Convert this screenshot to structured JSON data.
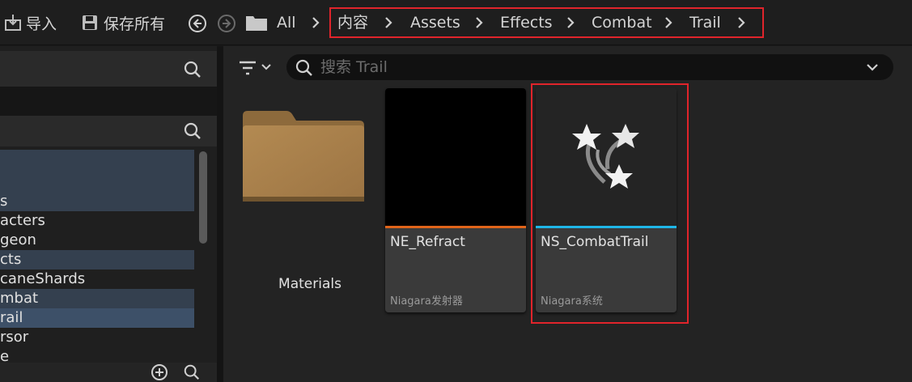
{
  "toolbar": {
    "import_label": "导入",
    "save_all_label": "保存所有"
  },
  "breadcrumb": {
    "root": "All",
    "items": [
      "内容",
      "Assets",
      "Effects",
      "Combat",
      "Trail"
    ]
  },
  "left_panel": {
    "tree_items": [
      "s",
      "acters",
      "geon",
      "cts",
      "caneShards",
      "mbat",
      "rail",
      "rsor",
      "e"
    ],
    "selected_item": "rail"
  },
  "content": {
    "search_placeholder": "搜索 Trail",
    "assets": [
      {
        "name": "Materials",
        "kind": "folder"
      },
      {
        "name": "NE_Refract",
        "type": "Niagara发射器",
        "accent": "#e0641a"
      },
      {
        "name": "NS_CombatTrail",
        "type": "Niagara系统",
        "accent": "#1fb6e8"
      }
    ]
  },
  "colors": {
    "highlight_box": "#e0242b",
    "selection_bg": "#3d5068",
    "folder": "#b0884f"
  }
}
